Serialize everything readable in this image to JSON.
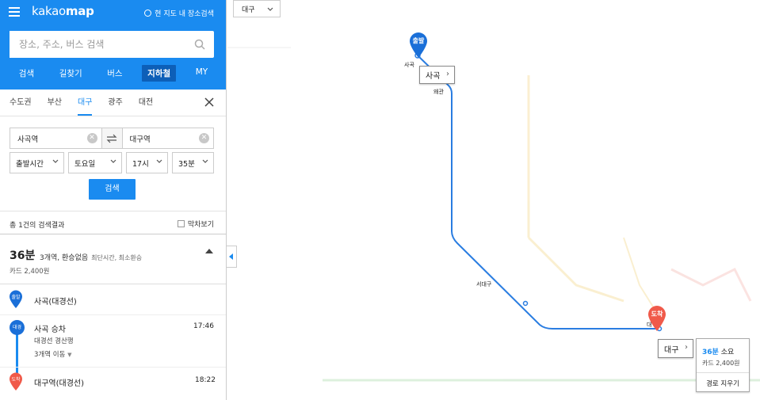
{
  "header": {
    "logo_light": "kakao",
    "logo_bold": "map",
    "here_label": "현 지도 내 장소검색"
  },
  "search": {
    "placeholder": "장소, 주소, 버스 검색"
  },
  "nav_tabs": [
    "검색",
    "길찾기",
    "버스",
    "지하철",
    "MY"
  ],
  "active_tab": "지하철",
  "regions": [
    "수도권",
    "부산",
    "대구",
    "광주",
    "대전"
  ],
  "active_region": "대구",
  "route": {
    "from": "사곡역",
    "to": "대구역",
    "clear_glyph": "✕"
  },
  "time_selectors": {
    "mode": "출발시간",
    "day": "토요일",
    "hour": "17시",
    "minute": "35분"
  },
  "search_button": "검색",
  "results": {
    "count_label": "총 1건의 검색결과",
    "fare_toggle": "막차보기"
  },
  "summary": {
    "duration": "36분",
    "info": "3개역, 환승없음",
    "tags": "최단시간, 최소환승",
    "fare": "카드 2,400원"
  },
  "steps": {
    "start_badge": "출발",
    "start_station": "사곡(대경선)",
    "board_badge": "대경",
    "board_station": "사곡 승차",
    "board_time": "17:46",
    "board_line": "대경선 경산행",
    "board_stops": "3개역 이동",
    "end_badge": "도착",
    "end_station": "대구역(대경선)",
    "end_time": "18:22"
  },
  "map": {
    "city_select": "대구",
    "start_pin": "출발",
    "end_pin": "도착",
    "start_callout": "사곡",
    "end_callout": "대구",
    "stations": {
      "sagok": "사곡",
      "waegwan": "왜관",
      "seodaegu": "서대구",
      "daegu": "대"
    },
    "info": {
      "duration": "36분",
      "duration_suffix": "소요",
      "fare": "카드 2,400원",
      "clear": "경로 지우기"
    }
  },
  "colors": {
    "brand_blue": "#1a8bf0",
    "route_line": "#2a7de1",
    "arrive_red": "#f05a4a",
    "tab_active": "#0d5fb8"
  }
}
